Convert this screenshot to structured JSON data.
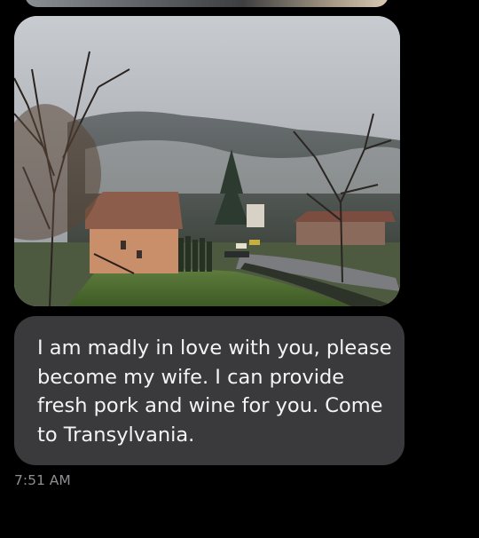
{
  "conversation": {
    "photo_message": {
      "type": "image",
      "subject": "misty-mountain-village-photo"
    },
    "text_message": {
      "lines": [
        "I am madly in love with you, please",
        "become my wife. I can provide",
        "fresh pork and wine for you. Come",
        "to Transylvania."
      ]
    },
    "timestamp": "7:51 AM"
  },
  "colors": {
    "background": "#000000",
    "bubble": "#3a3a3c",
    "bubble_text": "#f4f4f4",
    "timestamp": "#8e8e93"
  }
}
